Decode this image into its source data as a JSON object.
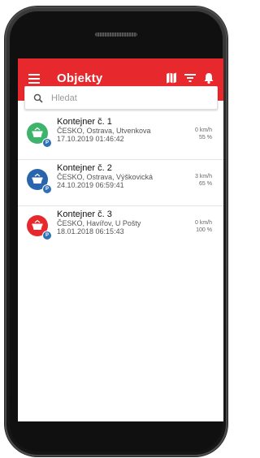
{
  "app": {
    "title": "Objekty",
    "accent_color": "#e7282d"
  },
  "toolbar": {
    "icons": [
      "menu-icon",
      "map-icon",
      "filter-icon",
      "bell-icon"
    ]
  },
  "search": {
    "placeholder": "Hledat",
    "value": "",
    "icon": "search-icon"
  },
  "items": [
    {
      "name": "Kontejner č. 1",
      "address": "ČESKO, Ostrava, Utvenkova",
      "datetime": "17.10.2019 01:46:42",
      "speed": "0 km/h",
      "fill": "55 %",
      "status_color": "#3db36b",
      "icon": "container-icon"
    },
    {
      "name": "Kontejner č. 2",
      "address": "ČESKO, Ostrava, Výškovická",
      "datetime": "24.10.2019 06:59:41",
      "speed": "3 km/h",
      "fill": "65 %",
      "status_color": "#2a64ad",
      "icon": "container-icon"
    },
    {
      "name": "Kontejner č. 3",
      "address": "ČESKO, Havířov, U Pošty",
      "datetime": "18.01.2018 06:15:43",
      "speed": "0 km/h",
      "fill": "100 %",
      "status_color": "#e7282d",
      "icon": "container-icon"
    }
  ]
}
